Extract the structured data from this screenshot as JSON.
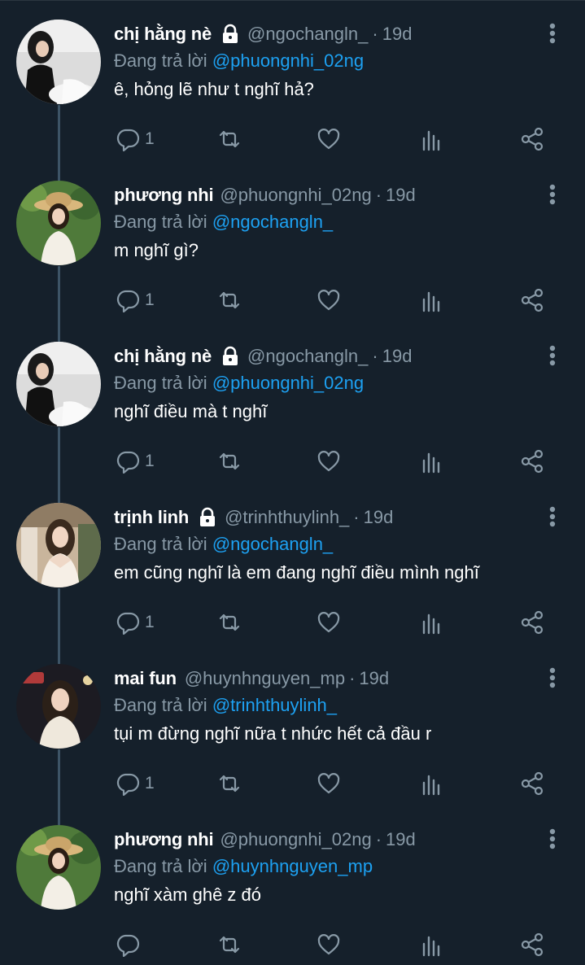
{
  "colors": {
    "background": "#15202b",
    "muted": "#8899a6",
    "mention": "#1da1f2",
    "thread_line": "#3d5466"
  },
  "icons": {
    "protected": "lock-icon",
    "more": "more-vertical-icon",
    "reply": "reply-icon",
    "retweet": "retweet-icon",
    "like": "heart-icon",
    "views": "analytics-icon",
    "share": "share-icon"
  },
  "tweets": [
    {
      "name": "chị hằng nè",
      "protected": true,
      "handle": "@ngochangln_",
      "separator": "·",
      "time": "19d",
      "reply_prefix": "Đang trả lời",
      "reply_to": "@phuongnhi_02ng",
      "text": "ê, hỏng lẽ như t nghĩ hả?",
      "reply_count": "1"
    },
    {
      "name": "phương nhi",
      "protected": false,
      "handle": "@phuongnhi_02ng",
      "separator": "·",
      "time": "19d",
      "reply_prefix": "Đang trả lời",
      "reply_to": "@ngochangln_",
      "text": "m nghĩ gì?",
      "reply_count": "1"
    },
    {
      "name": "chị hằng nè",
      "protected": true,
      "handle": "@ngochangln_",
      "separator": "·",
      "time": "19d",
      "reply_prefix": "Đang trả lời",
      "reply_to": "@phuongnhi_02ng",
      "text": "nghĩ điều mà t nghĩ",
      "reply_count": "1"
    },
    {
      "name": "trịnh linh",
      "protected": true,
      "handle": "@trinhthuylinh_",
      "separator": "·",
      "time": "19d",
      "reply_prefix": "Đang trả lời",
      "reply_to": "@ngochangln_",
      "text": "em cũng nghĩ là em đang nghĩ điều mình nghĩ",
      "reply_count": "1"
    },
    {
      "name": "mai fun",
      "protected": false,
      "handle": "@huynhnguyen_mp",
      "separator": "·",
      "time": "19d",
      "reply_prefix": "Đang trả lời",
      "reply_to": "@trinhthuylinh_",
      "text": "tụi m đừng nghĩ nữa t nhức hết cả đầu r",
      "reply_count": "1"
    },
    {
      "name": "phương nhi",
      "protected": false,
      "handle": "@phuongnhi_02ng",
      "separator": "·",
      "time": "19d",
      "reply_prefix": "Đang trả lời",
      "reply_to": "@huynhnguyen_mp",
      "text": "nghĩ xàm ghê z đó",
      "reply_count": ""
    }
  ]
}
